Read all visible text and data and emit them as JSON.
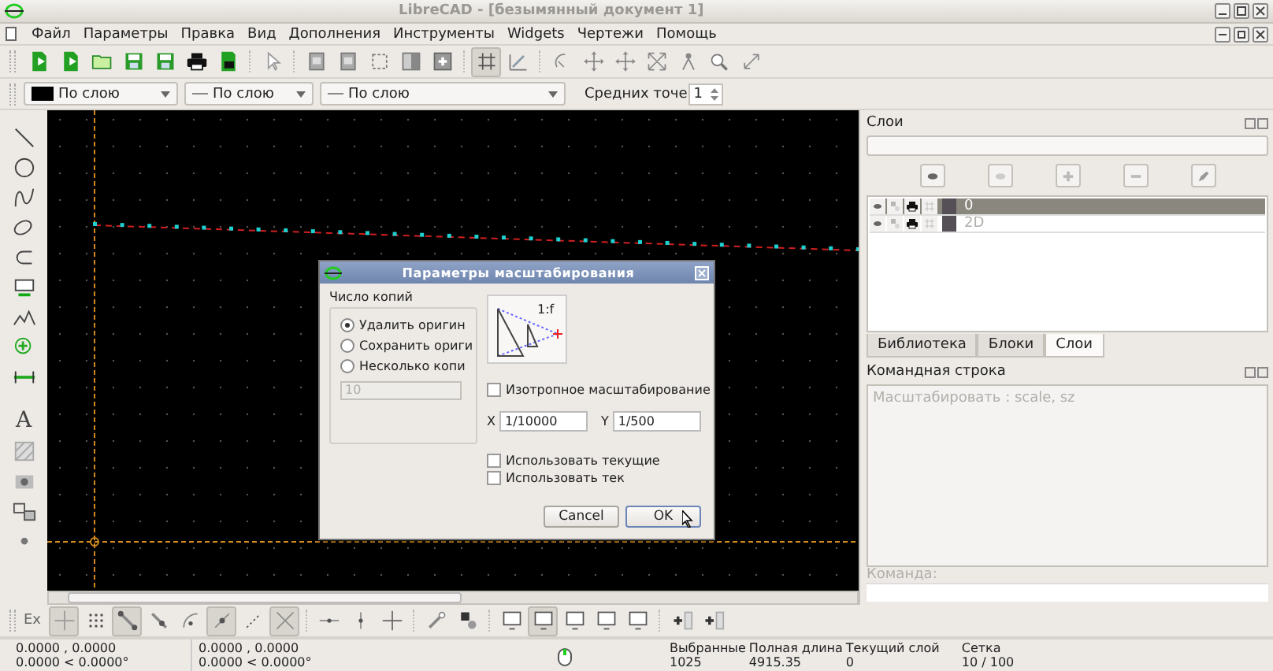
{
  "window": {
    "title": "LibreCAD - [безымянный документ 1]"
  },
  "menu": [
    "Файл",
    "Параметры",
    "Правка",
    "Вид",
    "Дополнения",
    "Инструменты",
    "Widgets",
    "Чертежи",
    "Помощь"
  ],
  "main_toolbar": [
    [
      {
        "kind": "new-file",
        "on": false
      },
      {
        "kind": "new-file",
        "on": false
      },
      {
        "kind": "folder",
        "on": false
      },
      {
        "kind": "floppy",
        "on": false
      },
      {
        "kind": "floppy",
        "on": false
      },
      {
        "kind": "printer",
        "on": false
      },
      {
        "kind": "print-preview",
        "on": false
      }
    ],
    [
      {
        "kind": "pointer",
        "on": false
      }
    ],
    [
      {
        "kind": "document",
        "on": false
      },
      {
        "kind": "document",
        "on": false
      },
      {
        "kind": "selection",
        "on": false
      },
      {
        "kind": "panel",
        "on": false
      },
      {
        "kind": "panel-plus",
        "on": false
      }
    ],
    [
      {
        "kind": "grid",
        "on": true
      },
      {
        "kind": "ruler",
        "on": false
      }
    ],
    [
      {
        "kind": "arc-tool",
        "on": false
      },
      {
        "kind": "move",
        "on": false
      },
      {
        "kind": "move",
        "on": false
      },
      {
        "kind": "expand",
        "on": false
      },
      {
        "kind": "figure",
        "on": false
      },
      {
        "kind": "magnifier",
        "on": false
      },
      {
        "kind": "pan",
        "on": false
      }
    ]
  ],
  "pen_toolbar": {
    "color_label": "По слою",
    "width": "По слою",
    "line_type": "По слою",
    "label": "Средних точе",
    "spin_value": "1"
  },
  "tool_palette": [
    [
      {
        "kind": "line"
      },
      {
        "kind": "circle"
      },
      {
        "kind": "spline"
      },
      {
        "kind": "ellipse"
      },
      {
        "kind": "arc"
      },
      {
        "kind": "dimension"
      },
      {
        "kind": "polyline"
      },
      {
        "kind": "circle-plus"
      },
      {
        "kind": "measure"
      }
    ],
    [
      {
        "kind": "text",
        "glyph": "A"
      },
      {
        "kind": "hatch"
      },
      {
        "kind": "image"
      },
      {
        "kind": "block"
      },
      {
        "kind": "point"
      }
    ]
  ],
  "dialog": {
    "title": "Параметры масштабирования",
    "copies_group": "Число копий",
    "copy_options": [
      {
        "label": "Удалить оригин",
        "selected": true
      },
      {
        "label": "Сохранить ориги",
        "selected": false
      },
      {
        "label": "Несколько копи",
        "selected": false
      }
    ],
    "copies_count": "10",
    "copies_count_disabled": true,
    "preview_label": "1:f",
    "isotropic": {
      "label": "Изотропное масштабирование",
      "checked": false
    },
    "x_label": "X",
    "x_value": "1/10000",
    "y_label": "Y",
    "y_value": "1/500",
    "options": [
      {
        "label": "Использовать текущие",
        "checked": false
      },
      {
        "label": "Использовать тек",
        "checked": false
      }
    ],
    "buttons": [
      {
        "label": "Cancel",
        "default": false
      },
      {
        "label": "OK",
        "default": true
      }
    ]
  },
  "layers": {
    "title": "Слои",
    "buttons": [
      {
        "kind": "show-all"
      },
      {
        "kind": "hide-all"
      },
      {
        "kind": "add"
      },
      {
        "kind": "remove"
      },
      {
        "kind": "edit"
      }
    ],
    "rows": [
      {
        "name": "0",
        "selected": true,
        "visible": true,
        "locked": false,
        "printable": true,
        "construction": false
      },
      {
        "name": "2D",
        "selected": false,
        "visible": true,
        "locked": false,
        "printable": true,
        "construction": false
      }
    ]
  },
  "dock_tabs": [
    {
      "label": "Библиотека",
      "selected": false
    },
    {
      "label": "Блоки",
      "selected": false
    },
    {
      "label": "Слои",
      "selected": true
    }
  ],
  "command_line": {
    "title": "Командная строка",
    "history": "Масштабировать : scale, sz",
    "prompt": "Команда:"
  },
  "snap_toolbar": {
    "label": "Ex",
    "groups": [
      [
        {
          "kind": "cross",
          "on": true
        },
        {
          "kind": "dot-grid",
          "on": false
        },
        {
          "kind": "snap-end",
          "on": true
        },
        {
          "kind": "snap-entity",
          "on": false
        },
        {
          "kind": "snap-center",
          "on": false
        },
        {
          "kind": "snap-middle",
          "on": true
        },
        {
          "kind": "snap-distance",
          "on": false
        },
        {
          "kind": "intersection",
          "on": true
        }
      ],
      [
        {
          "kind": "restrict-h",
          "on": false
        },
        {
          "kind": "restrict-v",
          "on": false
        },
        {
          "kind": "restrict-ortho",
          "on": false
        }
      ],
      [
        {
          "kind": "relative-zero",
          "on": false
        },
        {
          "kind": "lock-zero",
          "on": false
        }
      ],
      [
        {
          "kind": "monitor",
          "on": false
        },
        {
          "kind": "monitor",
          "on": true
        },
        {
          "kind": "monitor",
          "on": false
        },
        {
          "kind": "monitor",
          "on": false
        },
        {
          "kind": "monitor",
          "on": false
        }
      ],
      [
        {
          "kind": "insert-block",
          "on": false
        },
        {
          "kind": "insert-block",
          "on": false
        }
      ]
    ]
  },
  "status_bar": {
    "coordinates": [
      {
        "absolute": "0.0000 , 0.0000",
        "polar": "0.0000 < 0.0000°"
      },
      {
        "absolute": "0.0000 , 0.0000",
        "polar": "0.0000 < 0.0000°"
      }
    ],
    "fields": [
      {
        "label": "Выбранные",
        "value": "1025"
      },
      {
        "label": "Полная длина",
        "value": "4915.35"
      },
      {
        "label": "Текущий слой",
        "value": "0"
      },
      {
        "label": "Сетка",
        "value": "10 / 100"
      }
    ]
  }
}
